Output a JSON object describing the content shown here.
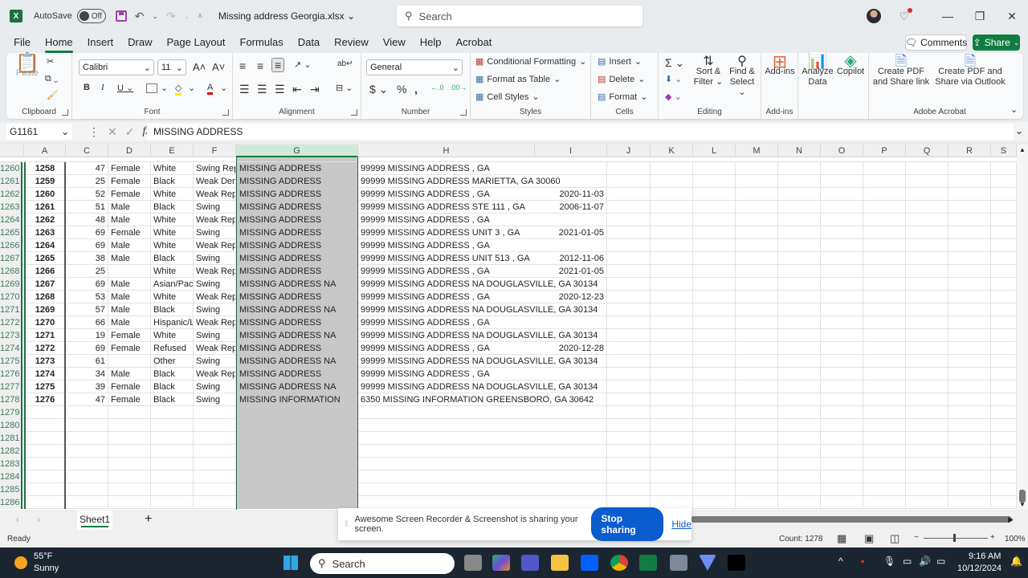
{
  "titlebar": {
    "autosave_label": "AutoSave",
    "autosave_state": "Off",
    "document_title": "Missing address Georgia.xlsx",
    "search_placeholder": "Search"
  },
  "menu": {
    "tabs": [
      "File",
      "Home",
      "Insert",
      "Draw",
      "Page Layout",
      "Formulas",
      "Data",
      "Review",
      "View",
      "Help",
      "Acrobat"
    ],
    "active": "Home",
    "comments_label": "Comments",
    "share_label": "Share"
  },
  "ribbon": {
    "clipboard": {
      "label": "Clipboard",
      "paste": "Paste"
    },
    "font": {
      "label": "Font",
      "font_name": "Calibri",
      "font_size": "11"
    },
    "alignment": {
      "label": "Alignment"
    },
    "number": {
      "label": "Number",
      "format": "General"
    },
    "styles": {
      "label": "Styles",
      "conditional": "Conditional Formatting",
      "format_table": "Format as Table",
      "cell_styles": "Cell Styles"
    },
    "cells": {
      "label": "Cells",
      "insert": "Insert",
      "delete": "Delete",
      "format": "Format"
    },
    "editing": {
      "label": "Editing",
      "sort": "Sort &",
      "sort2": "Filter",
      "find": "Find &",
      "find2": "Select"
    },
    "addins": {
      "label": "Add-ins",
      "addins": "Add-ins"
    },
    "analyze": {
      "analyze": "Analyze",
      "analyze2": "Data",
      "copilot": "Copilot"
    },
    "acrobat": {
      "label": "Adobe Acrobat",
      "create_pdf": "Create PDF",
      "create_pdf2": "and Share link",
      "create_outlook": "Create PDF and",
      "create_outlook2": "Share via Outlook"
    }
  },
  "formula_bar": {
    "name_box": "G1161",
    "formula": "MISSING ADDRESS"
  },
  "columns": [
    "A",
    "C",
    "D",
    "E",
    "F",
    "G",
    "H",
    "I",
    "J",
    "K",
    "L",
    "M",
    "N",
    "O",
    "P",
    "Q",
    "R",
    "S"
  ],
  "rows": [
    {
      "n": "1260",
      "a": "1258",
      "c": "47",
      "d": "Female",
      "e": "White",
      "f": "Swing Rep",
      "g": "MISSING ADDRESS",
      "h": "99999 MISSING ADDRESS  , GA",
      "i": ""
    },
    {
      "n": "1261",
      "a": "1259",
      "c": "25",
      "d": "Female",
      "e": "Black",
      "f": "Weak Dem",
      "g": "MISSING ADDRESS",
      "h": "99999 MISSING ADDRESS  MARIETTA, GA 30060",
      "i": ""
    },
    {
      "n": "1262",
      "a": "1260",
      "c": "52",
      "d": "Female",
      "e": "White",
      "f": "Weak Rep",
      "g": "MISSING ADDRESS",
      "h": "99999 MISSING ADDRESS  , GA",
      "i": "2020-11-03"
    },
    {
      "n": "1263",
      "a": "1261",
      "c": "51",
      "d": "Male",
      "e": "Black",
      "f": "Swing",
      "g": "MISSING ADDRESS",
      "h": "99999 MISSING ADDRESS  STE 111 , GA",
      "i": "2006-11-07"
    },
    {
      "n": "1264",
      "a": "1262",
      "c": "48",
      "d": "Male",
      "e": "White",
      "f": "Weak Rep",
      "g": "MISSING ADDRESS",
      "h": "99999 MISSING ADDRESS  , GA",
      "i": ""
    },
    {
      "n": "1265",
      "a": "1263",
      "c": "69",
      "d": "Female",
      "e": "White",
      "f": "Swing",
      "g": "MISSING ADDRESS",
      "h": "99999 MISSING ADDRESS  UNIT 3 , GA",
      "i": "2021-01-05"
    },
    {
      "n": "1266",
      "a": "1264",
      "c": "69",
      "d": "Male",
      "e": "White",
      "f": "Weak Rep",
      "g": "MISSING ADDRESS",
      "h": "99999 MISSING ADDRESS  , GA",
      "i": ""
    },
    {
      "n": "1267",
      "a": "1265",
      "c": "38",
      "d": "Male",
      "e": "Black",
      "f": "Swing",
      "g": "MISSING ADDRESS",
      "h": "99999 MISSING ADDRESS  UNIT 513 , GA",
      "i": "2012-11-06"
    },
    {
      "n": "1268",
      "a": "1266",
      "c": "25",
      "d": "",
      "e": "White",
      "f": "Weak Rep",
      "g": "MISSING ADDRESS",
      "h": "99999 MISSING ADDRESS  , GA",
      "i": "2021-01-05"
    },
    {
      "n": "1269",
      "a": "1267",
      "c": "69",
      "d": "Male",
      "e": "Asian/Paci",
      "f": "Swing",
      "g": "MISSING ADDRESS NA",
      "h": "99999 MISSING ADDRESS NA  DOUGLASVILLE, GA 30134",
      "i": ""
    },
    {
      "n": "1270",
      "a": "1268",
      "c": "53",
      "d": "Male",
      "e": "White",
      "f": "Weak Rep",
      "g": "MISSING ADDRESS",
      "h": "99999 MISSING ADDRESS  , GA",
      "i": "2020-12-23"
    },
    {
      "n": "1271",
      "a": "1269",
      "c": "57",
      "d": "Male",
      "e": "Black",
      "f": "Swing",
      "g": "MISSING ADDRESS NA",
      "h": "99999 MISSING ADDRESS NA  DOUGLASVILLE, GA 30134",
      "i": ""
    },
    {
      "n": "1272",
      "a": "1270",
      "c": "66",
      "d": "Male",
      "e": "Hispanic/L",
      "f": "Weak Rep",
      "g": "MISSING ADDRESS",
      "h": "99999 MISSING ADDRESS  , GA",
      "i": ""
    },
    {
      "n": "1273",
      "a": "1271",
      "c": "19",
      "d": "Female",
      "e": "White",
      "f": "Swing",
      "g": "MISSING ADDRESS NA",
      "h": "99999 MISSING ADDRESS NA  DOUGLASVILLE, GA 30134",
      "i": ""
    },
    {
      "n": "1274",
      "a": "1272",
      "c": "69",
      "d": "Female",
      "e": "Refused",
      "f": "Weak Rep",
      "g": "MISSING ADDRESS",
      "h": "99999 MISSING ADDRESS  , GA",
      "i": "2020-12-28"
    },
    {
      "n": "1275",
      "a": "1273",
      "c": "61",
      "d": "",
      "e": "Other",
      "f": "Swing",
      "g": "MISSING ADDRESS NA",
      "h": "99999 MISSING ADDRESS NA  DOUGLASVILLE, GA 30134",
      "i": ""
    },
    {
      "n": "1276",
      "a": "1274",
      "c": "34",
      "d": "Male",
      "e": "Black",
      "f": "Weak Rep",
      "g": "MISSING ADDRESS",
      "h": "99999 MISSING ADDRESS  , GA",
      "i": ""
    },
    {
      "n": "1277",
      "a": "1275",
      "c": "39",
      "d": "Female",
      "e": "Black",
      "f": "Swing",
      "g": "MISSING ADDRESS NA",
      "h": "99999 MISSING ADDRESS NA  DOUGLASVILLE, GA 30134",
      "i": ""
    },
    {
      "n": "1278",
      "a": "1276",
      "c": "47",
      "d": "Female",
      "e": "Black",
      "f": "Swing",
      "g": "MISSING INFORMATION",
      "h": "6350 MISSING INFORMATION  GREENSBORO, GA 30642",
      "i": ""
    },
    {
      "n": "1279"
    },
    {
      "n": "1280"
    },
    {
      "n": "1281"
    },
    {
      "n": "1282"
    },
    {
      "n": "1283"
    },
    {
      "n": "1284"
    },
    {
      "n": "1285"
    },
    {
      "n": "1286"
    }
  ],
  "sheet": {
    "tab": "Sheet1",
    "add": "+"
  },
  "status": {
    "ready": "Ready",
    "count": "Count: 1278",
    "zoom": "100%"
  },
  "toast": {
    "message": "Awesome Screen Recorder & Screenshot is sharing your screen.",
    "stop": "Stop sharing",
    "hide": "Hide"
  },
  "taskbar": {
    "weather_temp": "55°F",
    "weather_desc": "Sunny",
    "search": "Search",
    "time": "9:16 AM",
    "date": "10/12/2024"
  },
  "colors": {
    "excel_green": "#107c41",
    "selection_gray": "#c8c8c8",
    "stop_blue": "#0b5ccf",
    "taskbar": "#1b2631"
  }
}
